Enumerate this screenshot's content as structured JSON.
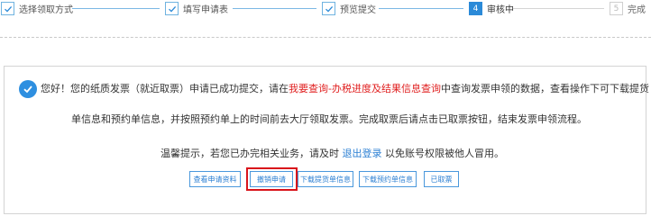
{
  "stepper": {
    "steps": [
      {
        "label": "选择领取方式",
        "state": "done",
        "icon": "check-icon"
      },
      {
        "label": "填写申请表",
        "state": "done",
        "icon": "check-icon"
      },
      {
        "label": "预览提交",
        "state": "done",
        "icon": "check-icon"
      },
      {
        "label": "审核中",
        "state": "active",
        "number": "4"
      },
      {
        "label": "完成",
        "state": "todo",
        "number": "5"
      }
    ]
  },
  "message": {
    "line1_before": "您好！您的纸质发票（就近取票）申请已成功提交，请在",
    "line1_link": "我要查询-办税进度及结果信息查询",
    "line1_after": "中查询发票申领的数据，查看操作下可下载提货",
    "line2": "单信息和预约单信息，并按照预约单上的时间前去大厅领取发票。完成取票后请点击已取票按钮，结束发票申领流程。",
    "line3_before": "温馨提示，若您已办完相关业务，请及时 ",
    "line3_link": "退出登录",
    "line3_after": " 以免账号权限被他人冒用。"
  },
  "buttons": {
    "view_application": "查看申请资料",
    "revoke_application": "撤销申请",
    "download_pickup": "下载提货单信息",
    "download_reservation": "下载预约单信息",
    "picked_up": "已取票"
  },
  "colors": {
    "accent": "#2b8ad8",
    "link_red": "#e02020",
    "highlight": "#d9141b"
  }
}
